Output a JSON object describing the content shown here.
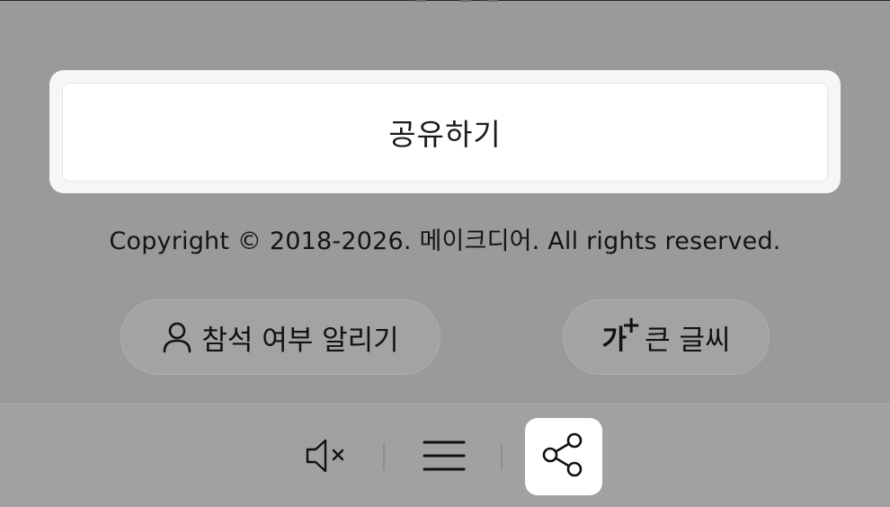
{
  "share_card": {
    "label": "공유하기"
  },
  "footer": {
    "copyright": "Copyright © 2018-2026. 메이크디어. All rights reserved."
  },
  "actions": {
    "rsvp_label": "참석 여부 알리기",
    "font_icon_text": "가",
    "font_icon_plus": "+",
    "font_label": "큰 글씨"
  },
  "bottom_bar": {
    "icons": [
      "mute-icon",
      "menu-icon",
      "share-icon"
    ],
    "active": "share"
  },
  "colors": {
    "overlay": "#9a9a9a",
    "card": "#ffffff",
    "text": "#111111"
  }
}
